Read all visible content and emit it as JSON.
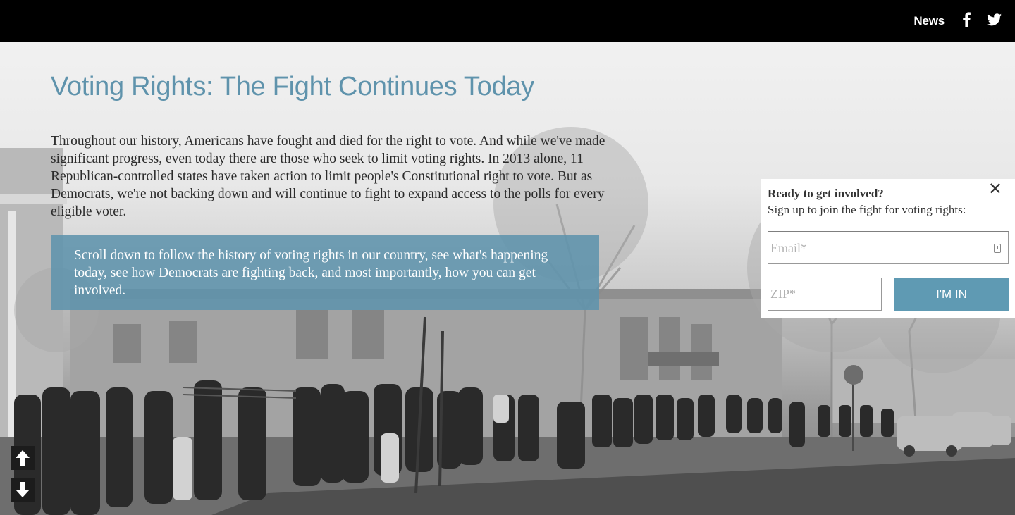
{
  "nav": {
    "news_label": "News",
    "facebook_icon": "facebook-icon",
    "twitter_icon": "twitter-icon"
  },
  "hero": {
    "title": "Voting Rights: The Fight Continues Today",
    "intro": "Throughout our history, Americans have fought and died for the right to vote. And while we've made significant progress, even today there are those who seek to limit voting rights. In 2013 alone, 11 Republican-controlled states have taken action to limit people's Constitutional right to vote. But as Democrats, we're not backing down and will continue to fight to expand access to the polls for every eligible voter.",
    "scroll_prompt": "Scroll down to follow the history of voting rights in our country, see what's happening today, see how Democrats are fighting back, and most importantly, how you can get involved."
  },
  "signup": {
    "heading": "Ready to get involved?",
    "subheading": "Sign up to join the fight for voting rights:",
    "close_symbol": "✕",
    "email_placeholder": "Email*",
    "zip_placeholder": "ZIP*",
    "submit_label": "I'M IN"
  },
  "scroll_controls": {
    "up_icon": "arrow-up-icon",
    "down_icon": "arrow-down-icon"
  },
  "colors": {
    "accent": "#5f93ac",
    "button": "#5f9ab3",
    "topbar": "#000000"
  }
}
